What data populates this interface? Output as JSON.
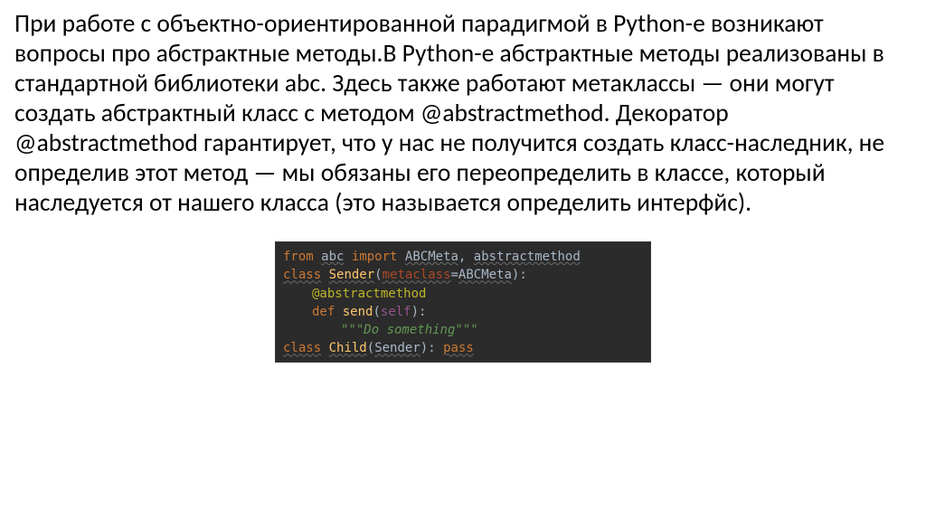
{
  "paragraph": "При работе с объектно-ориентированной парадигмой в Python-е возникают вопросы про абстрактные методы.В Python-е абстрактные методы реализованы в стандартной библиотеки abc. Здесь также работают метаклассы — они могут создать абстрактный класс с методом @abstractmethod. Декоратор @abstractmethod гарантирует, что у нас не получится создать класс-наследник, не определив этот метод — мы обязаны его переопределить в классе, который наследуется от нашего класса (это называется определить интерфйс).",
  "code": {
    "kw_from": "from",
    "mod_abc": "abc",
    "kw_import": "import",
    "imp_abcmeta": "ABCMeta",
    "imp_sep": ", ",
    "imp_am": "abstractmethod",
    "kw_class1": "class",
    "cls_sender": "Sender",
    "paren_open": "(",
    "arg_metaclass": "metaclass",
    "eq": "=",
    "arg_abcmeta": "ABCMeta",
    "paren_close_colon": "):",
    "decorator": "@abstractmethod",
    "kw_def": "def",
    "fn_send": "send",
    "lp": "(",
    "self": "self",
    "rp_colon": "):",
    "docstring": "\"\"\"Do something\"\"\"",
    "kw_class2": "class",
    "cls_child": "Child",
    "lp2": "(",
    "base_sender": "Sender",
    "rp2_colon": "):",
    "kw_pass": "pass"
  }
}
